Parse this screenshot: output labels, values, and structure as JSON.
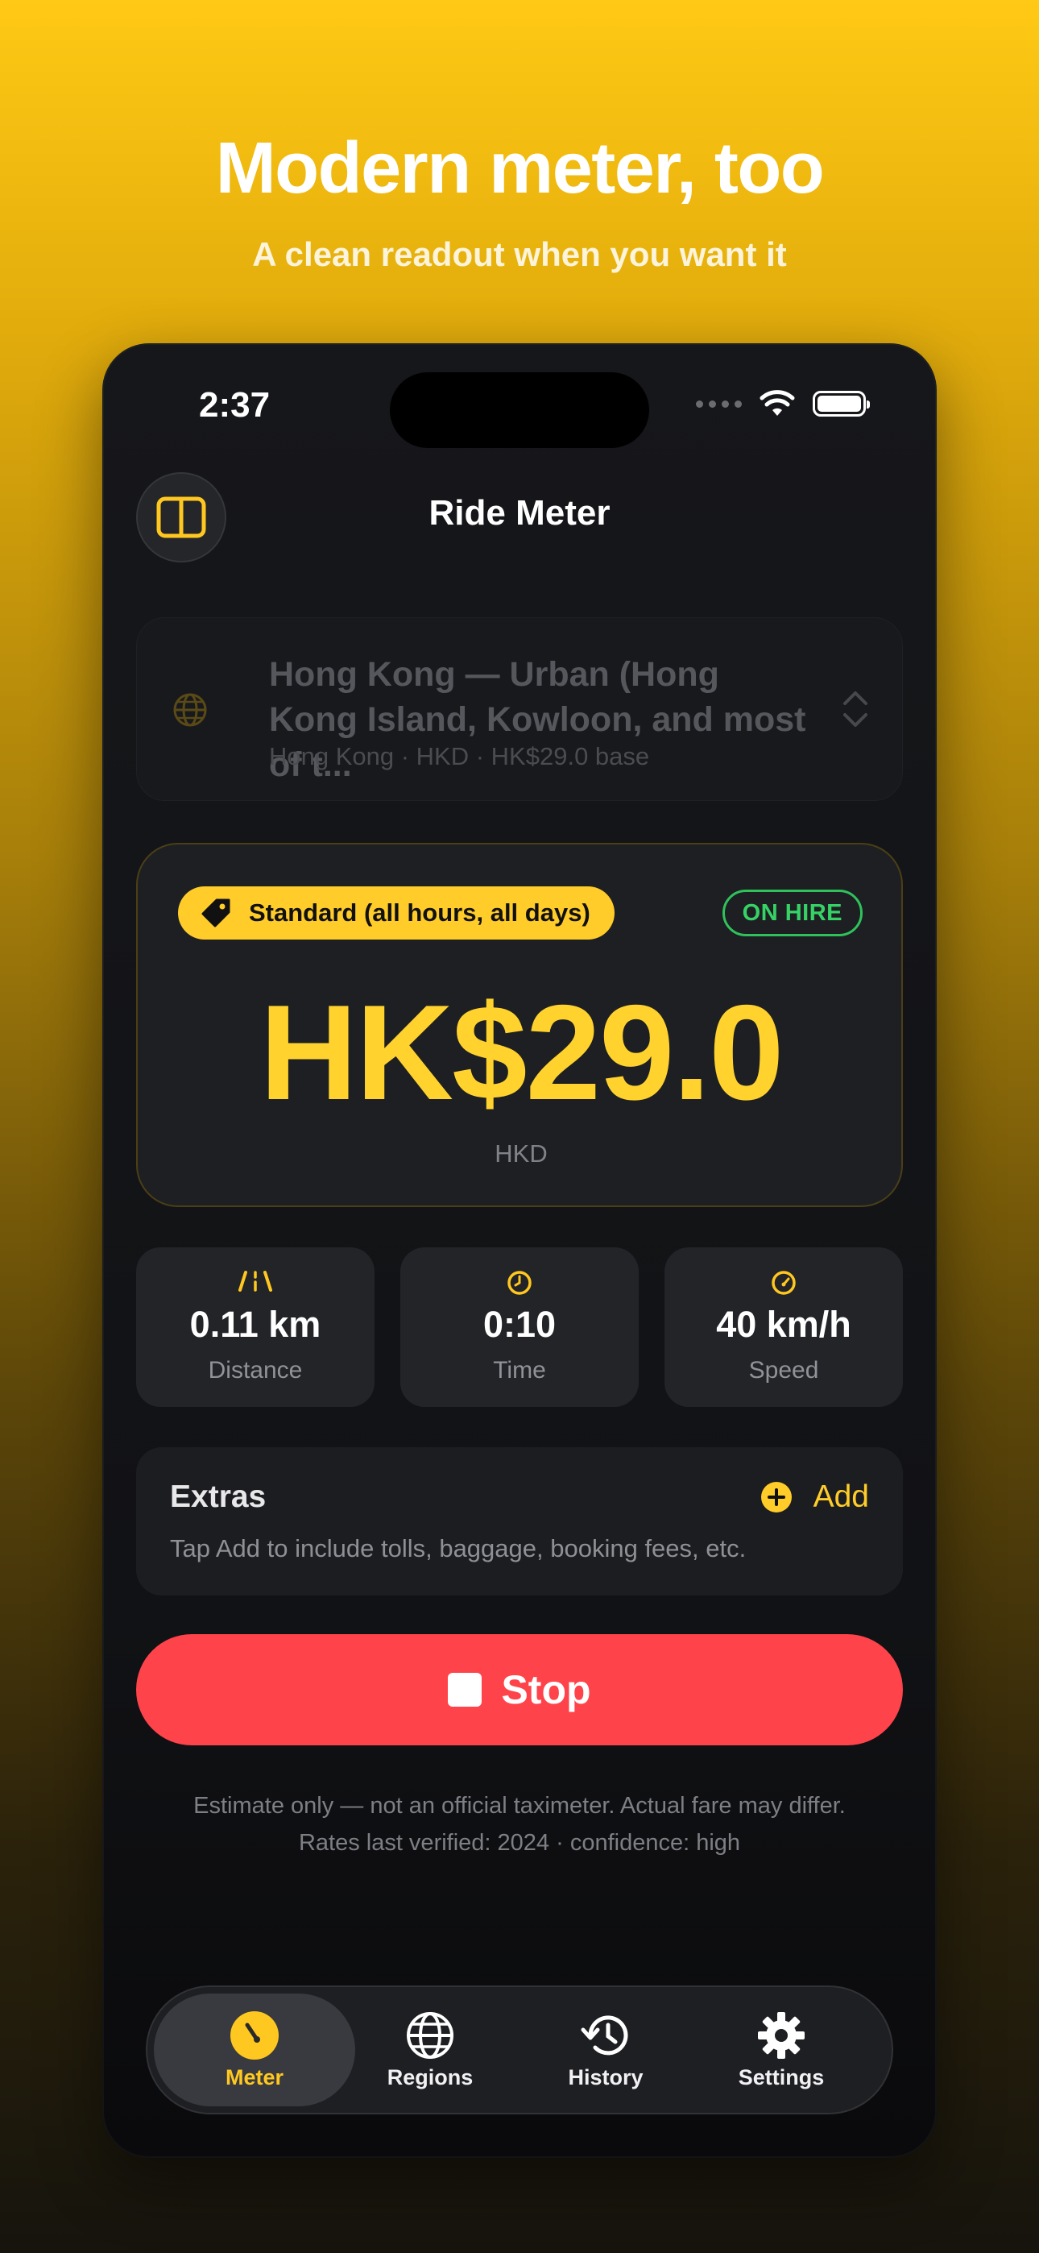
{
  "promo": {
    "headline": "Modern meter, too",
    "subheadline": "A clean readout when you want it"
  },
  "status_bar": {
    "time": "2:37"
  },
  "nav": {
    "title": "Ride Meter"
  },
  "region": {
    "name": "Hong Kong — Urban (Hong Kong Island, Kowloon, and most of t...",
    "meta": "Hong Kong  ·  HKD  ·  HK$29.0 base"
  },
  "fare": {
    "tariff_label": "Standard (all hours, all days)",
    "status": "ON HIRE",
    "amount": "HK$29.0",
    "currency": "HKD"
  },
  "stats": {
    "distance": {
      "value": "0.11 km",
      "label": "Distance"
    },
    "time": {
      "value": "0:10",
      "label": "Time"
    },
    "speed": {
      "value": "40 km/h",
      "label": "Speed"
    }
  },
  "extras": {
    "title": "Extras",
    "add_label": "Add",
    "hint": "Tap Add to include tolls, baggage, booking fees, etc."
  },
  "stop_button": {
    "label": "Stop"
  },
  "disclaimer": {
    "line1": "Estimate only — not an official taximeter. Actual fare may differ.",
    "line2": "Rates last verified: 2024 · confidence: high"
  },
  "tabs": [
    {
      "label": "Meter",
      "icon": "gauge-icon",
      "active": true
    },
    {
      "label": "Regions",
      "icon": "globe-icon",
      "active": false
    },
    {
      "label": "History",
      "icon": "history-clock-icon",
      "active": false
    },
    {
      "label": "Settings",
      "icon": "gear-icon",
      "active": false
    }
  ],
  "colors": {
    "accent": "#ffcc2a",
    "stop": "#ff434a",
    "on_hire": "#37d266"
  }
}
